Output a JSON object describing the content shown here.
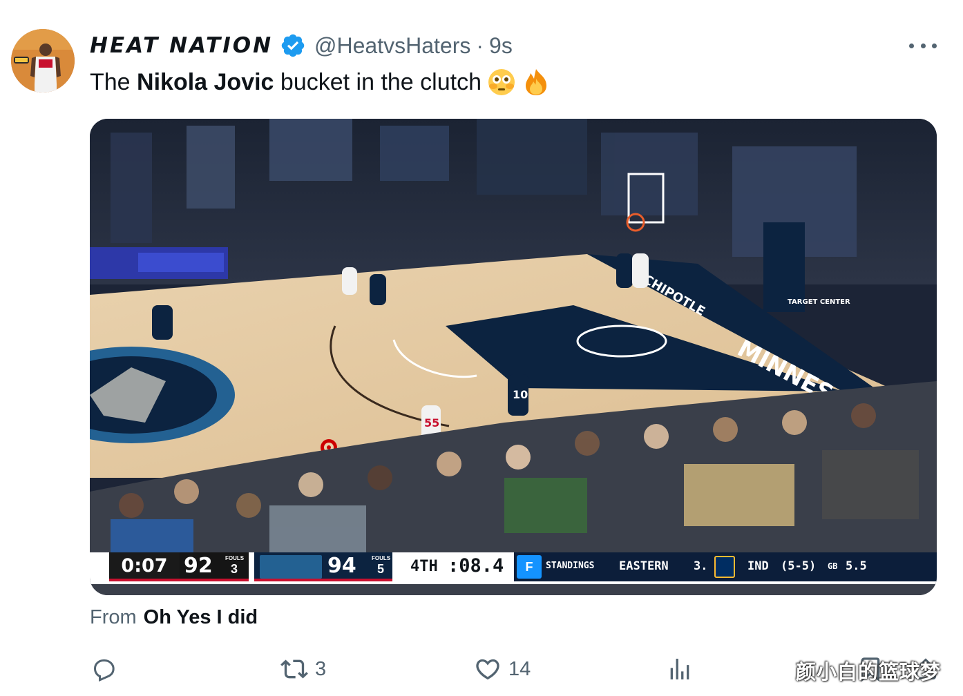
{
  "tweet": {
    "display_name": "HEAT NATION",
    "handle": "@HeatvsHaters",
    "separator": "·",
    "time": "9s",
    "text_prefix": "The ",
    "text_bold": "Nikola Jovic",
    "text_suffix": " bucket in the clutch",
    "emojis": [
      "flushed-face",
      "fire"
    ],
    "source_prefix": "From",
    "source_name": "Oh Yes I did"
  },
  "scorebug": {
    "game_clock": "0:07",
    "home_score": "92",
    "home_fouls_label": "FOULS",
    "home_fouls": "3",
    "away_score": "94",
    "away_fouls_label": "FOULS",
    "away_fouls": "5",
    "quarter": "4TH",
    "shot_clock": ":08.4",
    "standings_label": "STANDINGS",
    "conference": "EASTERN",
    "rank": "3.",
    "team": "IND",
    "record": "(5-5)",
    "gb_label": "GB",
    "gb": "5.5"
  },
  "court_signage": {
    "baseline_word": "MINNES",
    "paint_word": "CHIPOTLE",
    "stanchion_text": "TARGET CENTER",
    "jersey_number": "10",
    "jersey_number_2": "55"
  },
  "actions": {
    "reply_count": "",
    "retweet_count": "3",
    "like_count": "14",
    "views_count": ""
  },
  "watermark": "颜小白的篮球梦",
  "colors": {
    "text_primary": "#0f1419",
    "text_secondary": "#536471",
    "verified_blue": "#1d9bf0",
    "court_navy": "#0c2340",
    "heat_red": "#c8102e"
  }
}
